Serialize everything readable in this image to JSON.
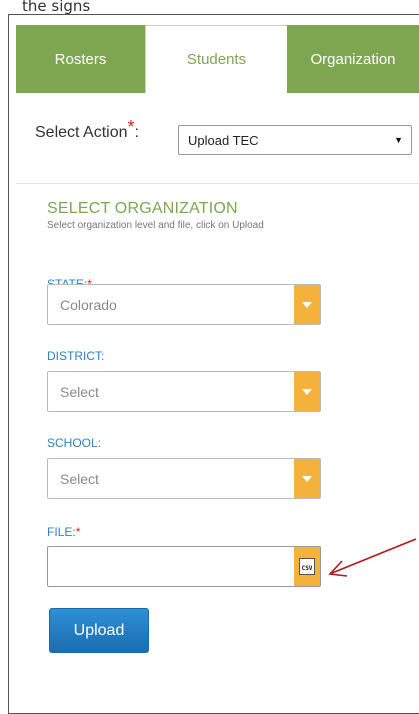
{
  "caption": "the signs",
  "tabs": [
    {
      "label": "Rosters",
      "active": false
    },
    {
      "label": "Students",
      "active": true
    },
    {
      "label": "Organization",
      "active": false
    }
  ],
  "action": {
    "label": "Select Action",
    "required_mark": "*",
    "colon": ":",
    "selected": "Upload TEC"
  },
  "section": {
    "title": "SELECT ORGANIZATION",
    "help": "Select organization level and file, click on Upload"
  },
  "fields": {
    "state": {
      "label": "STATE:",
      "required_mark": "*",
      "value": "Colorado"
    },
    "district": {
      "label": "DISTRICT:",
      "value": "Select"
    },
    "school": {
      "label": "SCHOOL:",
      "value": "Select"
    },
    "file": {
      "label": "FILE:",
      "required_mark": "*",
      "value": "",
      "icon_text": "CSV"
    }
  },
  "upload_button": "Upload",
  "colors": {
    "accent_green": "#7da650",
    "dropdown_orange": "#f4b23d",
    "label_blue": "#2f7fc1",
    "button_blue": "#1a6db0",
    "annotation_red": "#b01818"
  },
  "icons": {
    "dropdown": "caret-down-icon",
    "file": "csv-file-icon",
    "annotation": "red-arrow-icon"
  }
}
